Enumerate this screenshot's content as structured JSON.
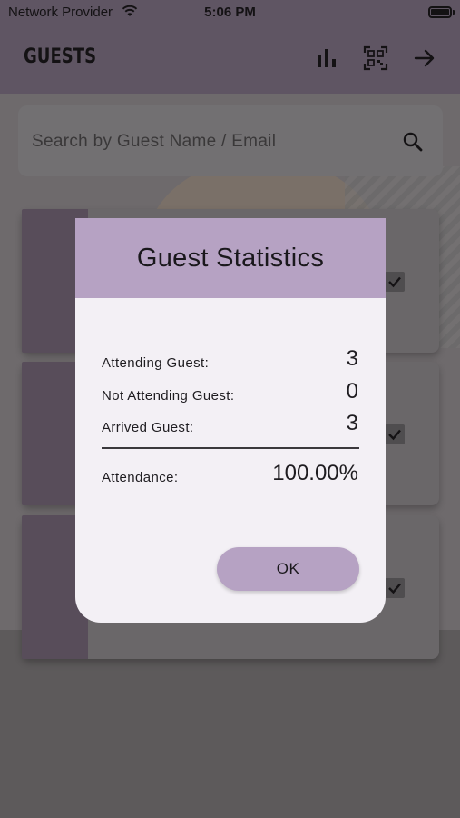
{
  "status_bar": {
    "carrier": "Network Provider",
    "time": "5:06 PM"
  },
  "app_bar": {
    "title": "GUESTS",
    "icons": [
      "bar-chart-icon",
      "qr-scan-icon",
      "arrow-right-icon"
    ]
  },
  "search": {
    "placeholder": "Search by Guest Name / Email"
  },
  "guest_list": {
    "items": [
      {
        "checked": true
      },
      {
        "checked": true
      },
      {
        "checked": true
      }
    ]
  },
  "dialog": {
    "title": "Guest Statistics",
    "rows": [
      {
        "label": "Attending Guest:",
        "value": "3"
      },
      {
        "label": "Not Attending Guest:",
        "value": "0"
      },
      {
        "label": "Arrived Guest:",
        "value": "3"
      }
    ],
    "attendance": {
      "label": "Attendance:",
      "value": "100.00%"
    },
    "ok_label": "OK"
  },
  "colors": {
    "app_bar": "#5f5563",
    "dialog_header": "#b6a2c3",
    "dialog_body": "#f3f0f5",
    "card_stripe": "#584d5a"
  }
}
